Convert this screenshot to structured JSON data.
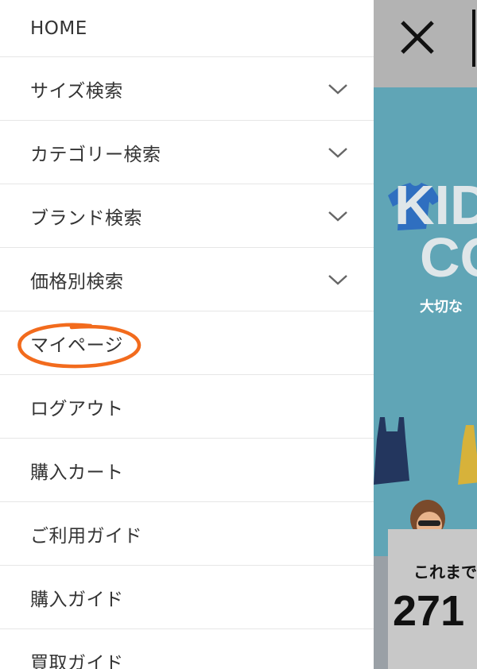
{
  "menu": {
    "items": [
      {
        "label": "HOME",
        "expandable": false
      },
      {
        "label": "サイズ検索",
        "expandable": true
      },
      {
        "label": "カテゴリー検索",
        "expandable": true
      },
      {
        "label": "ブランド検索",
        "expandable": true
      },
      {
        "label": "価格別検索",
        "expandable": true
      },
      {
        "label": "マイページ",
        "expandable": false,
        "highlighted": true
      },
      {
        "label": "ログアウト",
        "expandable": false
      },
      {
        "label": "購入カート",
        "expandable": false
      },
      {
        "label": "ご利用ガイド",
        "expandable": false
      },
      {
        "label": "購入ガイド",
        "expandable": false
      },
      {
        "label": "買取ガイド",
        "expandable": false
      }
    ]
  },
  "background": {
    "close_icon": "close-icon",
    "banner": {
      "line1": "KID",
      "line2": "CO",
      "subtitle": "大切な"
    },
    "stats": {
      "label": "これまで",
      "number": "271"
    }
  },
  "colors": {
    "annotation": "#f26b1d",
    "banner": "#60a5b6",
    "text": "#333333"
  }
}
